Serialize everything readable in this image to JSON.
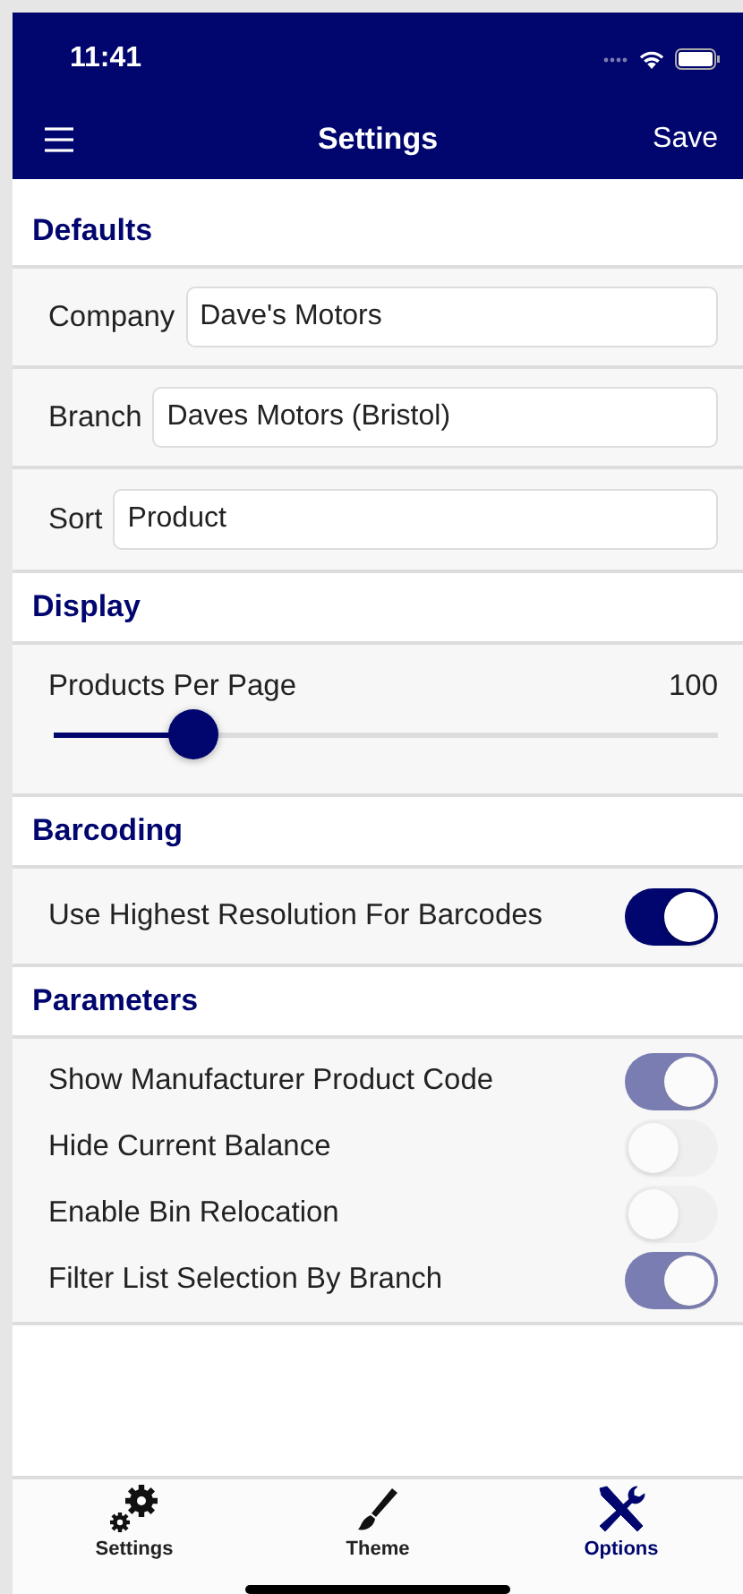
{
  "status_bar": {
    "time": "11:41"
  },
  "nav_bar": {
    "title": "Settings",
    "action": "Save"
  },
  "sections": [
    {
      "title": "Defaults",
      "kind": "fields",
      "rows": [
        {
          "label": "Company",
          "value": "Dave's Motors"
        },
        {
          "label": "Branch",
          "value": "Daves Motors (Bristol)"
        },
        {
          "label": "Sort",
          "value": "Product"
        }
      ]
    },
    {
      "title": "Display",
      "kind": "slider",
      "label": "Products Per Page",
      "reading": "100",
      "level": 0.21
    },
    {
      "title": "Barcoding",
      "kind": "toggles",
      "rows": [
        {
          "label": "Use Highest Resolution For Barcodes",
          "on": true,
          "disabled": false
        }
      ]
    },
    {
      "title": "Parameters",
      "kind": "toggles",
      "rows": [
        {
          "label": "Show Manufacturer Product Code",
          "on": true,
          "disabled": true
        },
        {
          "label": "Hide Current Balance",
          "on": false,
          "disabled": true
        },
        {
          "label": "Enable Bin Relocation",
          "on": false,
          "disabled": true
        },
        {
          "label": "Filter List Selection By Branch",
          "on": true,
          "disabled": true
        }
      ]
    }
  ],
  "tab_bar": [
    {
      "label": "Settings",
      "kind": "gears",
      "selected": false
    },
    {
      "label": "Theme",
      "kind": "brush",
      "selected": false
    },
    {
      "label": "Options",
      "kind": "tools",
      "selected": true
    }
  ]
}
